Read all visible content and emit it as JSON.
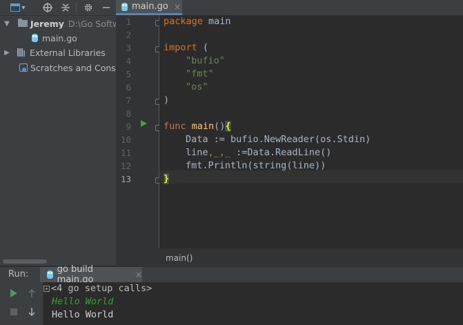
{
  "project": {
    "toolbar": {
      "view_icon": "project-view-icon",
      "dropdown_caret": "▾",
      "locate_icon": "crosshair-icon",
      "collapse_icon": "collapse-all-icon",
      "settings_icon": "gear-icon",
      "hide_icon": "minimize-icon"
    },
    "tree": {
      "root_name": "Jeremy",
      "root_path": "D:\\Go Softwa",
      "file": "main.go",
      "external_libraries": "External Libraries",
      "scratches": "Scratches and Consol"
    }
  },
  "editor": {
    "tab": {
      "label": "main.go",
      "close": "×"
    },
    "line_numbers": [
      "1",
      "2",
      "3",
      "4",
      "5",
      "6",
      "7",
      "8",
      "9",
      "10",
      "11",
      "12",
      "13"
    ],
    "current_line": "13",
    "code": {
      "l1_kw": "package",
      "l1_rest": " main",
      "l3_kw": "import",
      "l3_rest": " (",
      "l4": "\"bufio\"",
      "l5": "\"fmt\"",
      "l6": "\"os\"",
      "l7": ")",
      "l9_kw": "func",
      "l9_fn": "main",
      "l9_parens": "()",
      "l9_brace": "{",
      "l10": "Data := bufio.NewReader(os.Stdin)",
      "l11_a": "line",
      "l11_b": ",_,_",
      "l11_c": " :=Data.ReadLine()",
      "l12_a": "fmt.Println(",
      "l12_b": "string",
      "l12_c": "(line))",
      "l13_brace": "}"
    },
    "breadcrumb": "main()"
  },
  "run": {
    "label": "Run:",
    "tab_label": "go build main.go",
    "tab_close": "×",
    "console": {
      "setup_calls": "<4 go setup calls>",
      "line1": "Hello World",
      "line2": "Hello World"
    }
  },
  "colors": {
    "keyword": "#cc7832",
    "string": "#6a8759",
    "function": "#ffc66d",
    "run_green": "#499c54",
    "console_italic_green": "#3c9f3c"
  }
}
